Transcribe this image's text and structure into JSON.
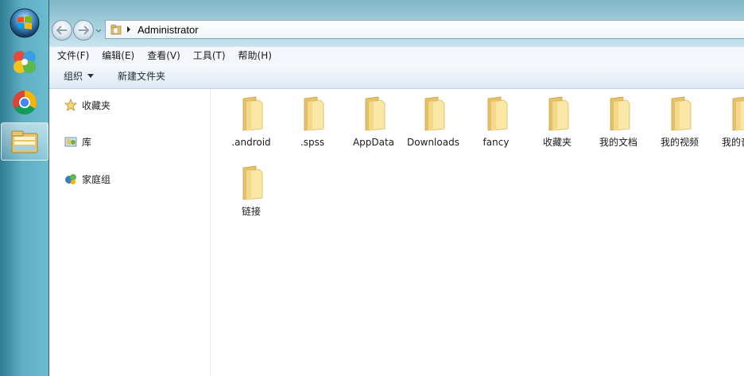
{
  "address_bar": {
    "current_location": "Administrator"
  },
  "menu": [
    {
      "label": "文件(F)"
    },
    {
      "label": "编辑(E)"
    },
    {
      "label": "查看(V)"
    },
    {
      "label": "工具(T)"
    },
    {
      "label": "帮助(H)"
    }
  ],
  "toolbar": {
    "organize_label": "组织",
    "new_folder_label": "新建文件夹"
  },
  "nav_pane": {
    "items": [
      {
        "label": "收藏夹",
        "icon": "star-icon"
      },
      {
        "label": "库",
        "icon": "library-icon"
      },
      {
        "label": "家庭组",
        "icon": "homegroup-icon"
      }
    ]
  },
  "files": [
    {
      "name": ".android"
    },
    {
      "name": ".spss"
    },
    {
      "name": "AppData"
    },
    {
      "name": "Downloads"
    },
    {
      "name": "fancy"
    },
    {
      "name": "收藏夹"
    },
    {
      "name": "我的文档"
    },
    {
      "name": "我的视频"
    },
    {
      "name": "我的音乐"
    },
    {
      "name": "链接"
    }
  ],
  "taskbar": {
    "items": [
      {
        "icon": "windows-start-icon"
      },
      {
        "icon": "app-pinwheel-icon"
      },
      {
        "icon": "chrome-icon"
      },
      {
        "icon": "explorer-icon",
        "active": true
      }
    ]
  },
  "colors": {
    "folder_light": "#fbe8a6",
    "folder_dark": "#e5c168",
    "taskbar": "#5eaec4"
  }
}
